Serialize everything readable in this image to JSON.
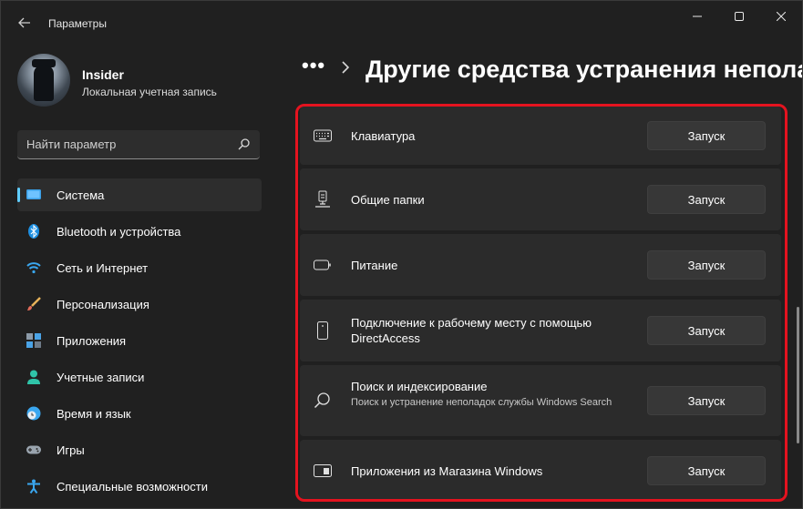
{
  "window": {
    "app_title": "Параметры",
    "controls": [
      "minimize",
      "maximize",
      "close"
    ]
  },
  "profile": {
    "name": "Insider",
    "account_type": "Локальная учетная запись"
  },
  "search": {
    "placeholder": "Найти параметр",
    "value": ""
  },
  "sidebar": {
    "items": [
      {
        "label": "Система",
        "icon": "system-monitor-icon",
        "selected": true
      },
      {
        "label": "Bluetooth и устройства",
        "icon": "bluetooth-icon",
        "selected": false
      },
      {
        "label": "Сеть и Интернет",
        "icon": "wifi-icon",
        "selected": false
      },
      {
        "label": "Персонализация",
        "icon": "brush-icon",
        "selected": false
      },
      {
        "label": "Приложения",
        "icon": "apps-icon",
        "selected": false
      },
      {
        "label": "Учетные записи",
        "icon": "person-icon",
        "selected": false
      },
      {
        "label": "Время и язык",
        "icon": "clock-globe-icon",
        "selected": false
      },
      {
        "label": "Игры",
        "icon": "gamepad-icon",
        "selected": false
      },
      {
        "label": "Специальные возможности",
        "icon": "accessibility-icon",
        "selected": false
      }
    ]
  },
  "header": {
    "breadcrumb_more": "•••",
    "title": "Другие средства устранения неполад"
  },
  "troubleshooters": [
    {
      "title": "Клавиатура",
      "description": "",
      "icon": "keyboard-icon",
      "button": "Запуск"
    },
    {
      "title": "Общие папки",
      "description": "",
      "icon": "shared-folder-icon",
      "button": "Запуск"
    },
    {
      "title": "Питание",
      "description": "",
      "icon": "battery-icon",
      "button": "Запуск"
    },
    {
      "title": "Подключение к рабочему месту с помощью DirectAccess",
      "description": "",
      "icon": "phone-device-icon",
      "button": "Запуск"
    },
    {
      "title": "Поиск и индексирование",
      "description": "Поиск и устранение неполадок службы Windows Search",
      "icon": "search-icon",
      "button": "Запуск"
    },
    {
      "title": "Приложения из Магазина Windows",
      "description": "",
      "icon": "store-app-icon",
      "button": "Запуск"
    }
  ],
  "colors": {
    "background": "#202020",
    "card": "#2b2b2b",
    "accent": "#60cdff",
    "highlight_border": "#e4131f"
  }
}
